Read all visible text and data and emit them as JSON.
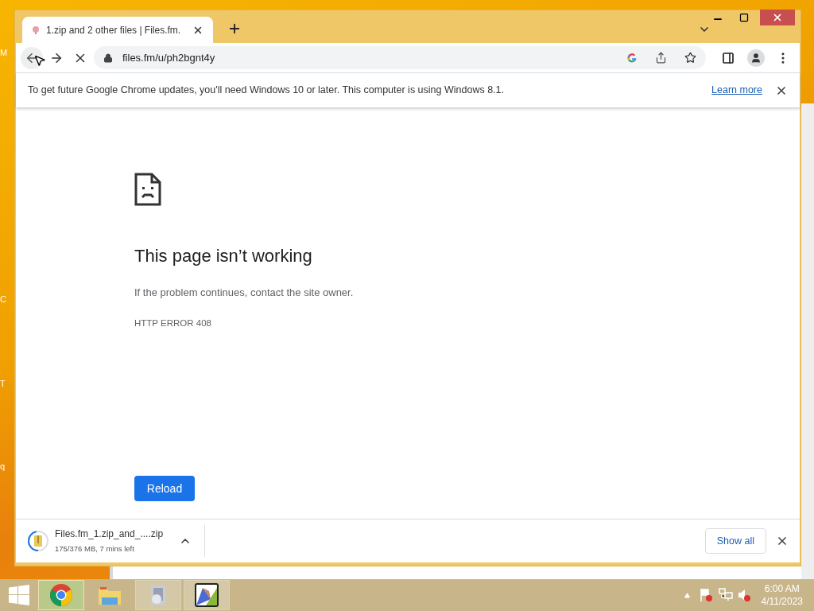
{
  "desktop": {
    "edge_labels": [
      "M",
      "C",
      "T",
      "q"
    ]
  },
  "browser": {
    "tabs": [
      {
        "title": "1.zip and 2 other files | Files.fm.",
        "selected": true
      }
    ],
    "address": "files.fm/u/ph2bgnt4y",
    "loading": true,
    "infobar": {
      "message": "To get future Google Chrome updates, you'll need Windows 10 or later. This computer is using Windows 8.1.",
      "link": "Learn more"
    },
    "error_page": {
      "title": "This page isn’t working",
      "message": "If the problem continues, contact the site owner.",
      "code": "HTTP ERROR 408",
      "button": "Reload"
    },
    "download": {
      "filename": "Files.fm_1.zip_and_....zip",
      "status": "175/376 MB, 7 mins left",
      "show_all": "Show all"
    }
  },
  "taskbar": {
    "apps": [
      {
        "kind": "chrome",
        "selected": true,
        "running": true
      },
      {
        "kind": "explorer",
        "selected": false,
        "running": false
      },
      {
        "kind": "installer",
        "selected": false,
        "running": true
      },
      {
        "kind": "chart",
        "selected": false,
        "running": true
      }
    ],
    "clock": {
      "time": "6:00 AM",
      "date": "4/11/2023"
    }
  }
}
